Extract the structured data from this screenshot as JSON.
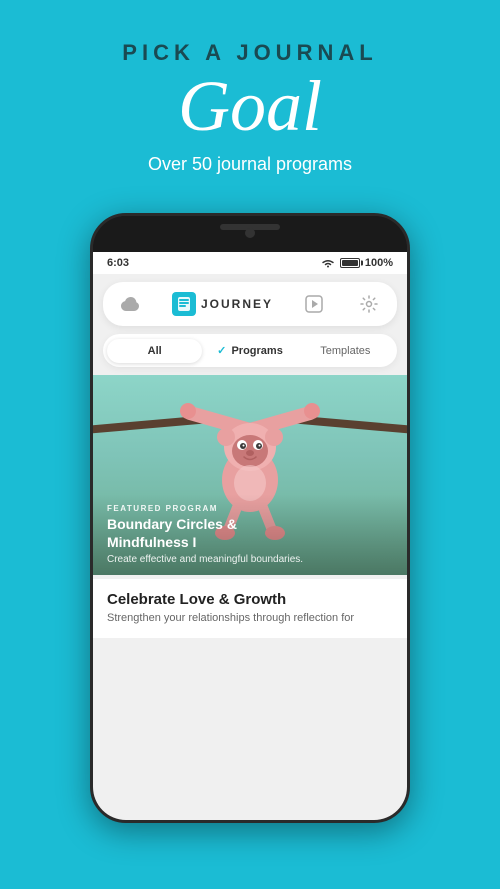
{
  "page": {
    "background_color": "#1BBCD4"
  },
  "header": {
    "pick_label": "PICK A JOURNAL",
    "goal_label": "Goal",
    "subtitle": "Over 50 journal programs"
  },
  "phone": {
    "status": {
      "time": "6:03",
      "battery_pct": "100%"
    },
    "app_header": {
      "cloud_icon": "☁",
      "logo_text": "JOURNEY",
      "play_icon": "▶",
      "gear_icon": "⚙"
    },
    "filter_tabs": [
      {
        "id": "all",
        "label": "All",
        "active": false
      },
      {
        "id": "programs",
        "label": "Programs",
        "active": true,
        "check": "✓"
      },
      {
        "id": "templates",
        "label": "Templates",
        "active": false
      }
    ],
    "featured": {
      "badge": "FEATURED PROGRAM",
      "title": "Boundary Circles &\nMindfulness I",
      "description": "Create effective and meaningful boundaries."
    },
    "bottom_card": {
      "title": "Celebrate Love & Growth",
      "description": "Strengthen your relationships through reflection for"
    }
  }
}
